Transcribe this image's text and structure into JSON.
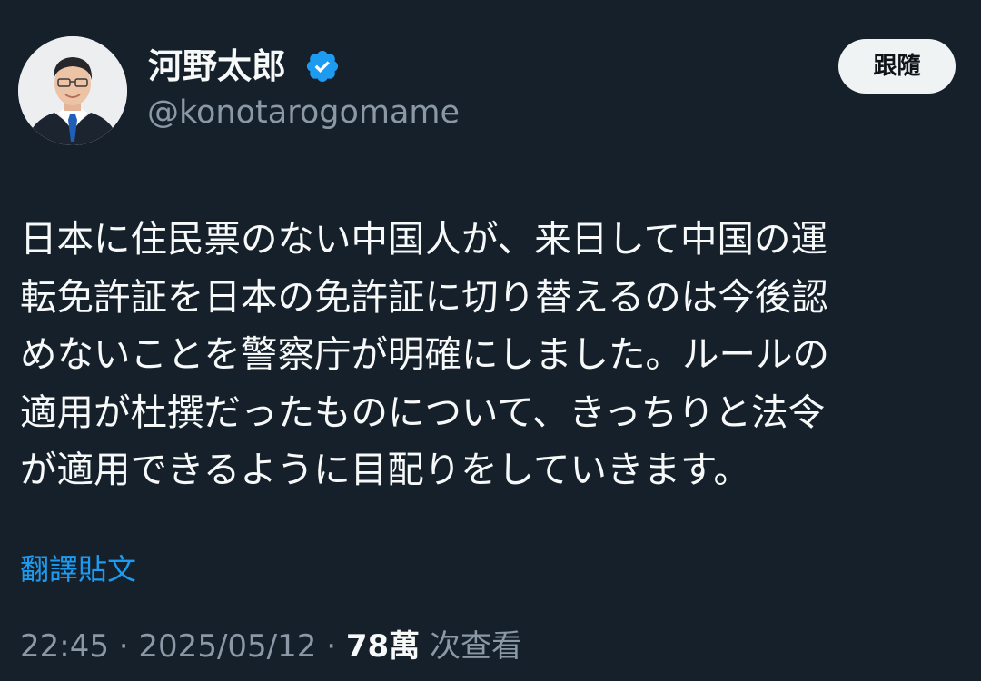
{
  "author": {
    "display_name": "河野太郎",
    "handle": "@konotarogomame",
    "verified": true
  },
  "follow_button": {
    "label": "跟隨"
  },
  "tweet": {
    "lines": [
      "日本に住民票のない中国人が、来日して中国の運",
      "転免許証を日本の免許証に切り替えるのは今後認",
      "めないことを警察庁が明確にしました。ルールの",
      "適用が杜撰だったものについて、きっちりと法令",
      "が適用できるように目配りをしていきます。"
    ]
  },
  "translate_link": "翻譯貼文",
  "meta": {
    "time": "22:45",
    "separator": "·",
    "date": "2025/05/12",
    "views_count": "78萬",
    "views_label": "次查看"
  },
  "colors": {
    "background": "#15202b",
    "text": "#f7f9f9",
    "secondary": "#8b98a5",
    "link": "#1d9bf0",
    "verified_badge": "#1d9bf0"
  },
  "icons": {
    "verified": "verified-badge-icon"
  }
}
